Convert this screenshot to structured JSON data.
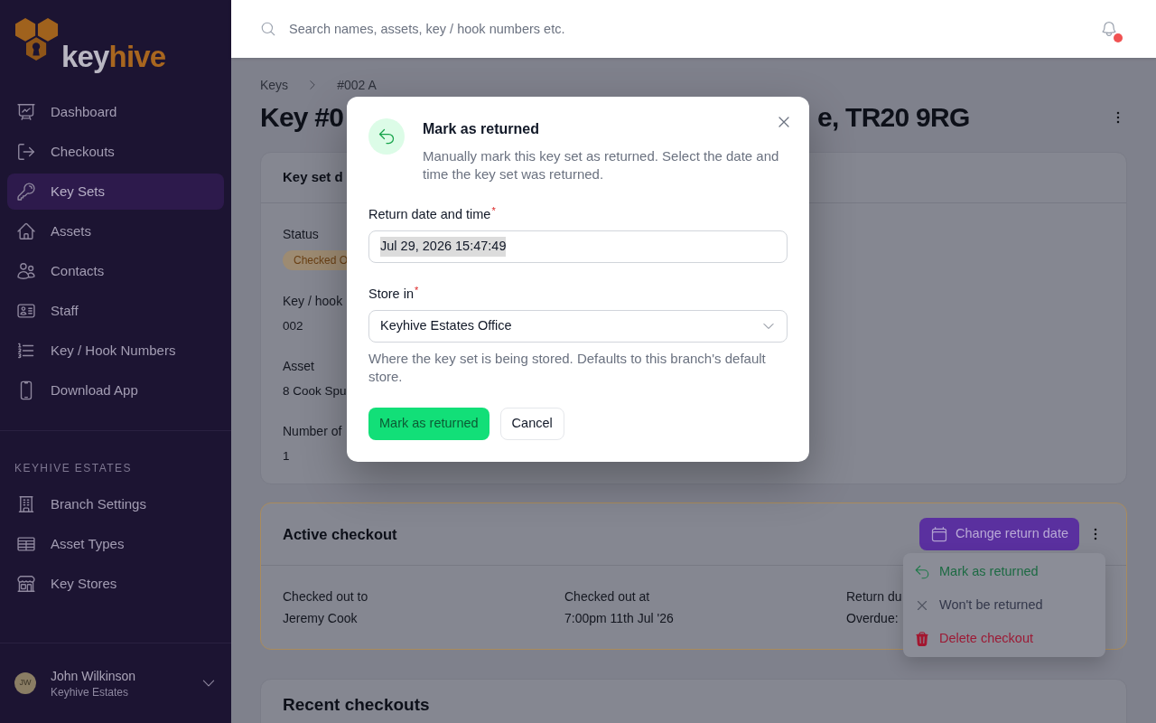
{
  "sidebar": {
    "logo": {
      "text": [
        "key",
        "hive"
      ]
    },
    "nav": [
      {
        "label": "Dashboard",
        "selected": false
      },
      {
        "label": "Checkouts",
        "selected": false
      },
      {
        "label": "Key Sets",
        "selected": true
      },
      {
        "label": "Assets",
        "selected": false
      },
      {
        "label": "Contacts",
        "selected": false
      },
      {
        "label": "Staff",
        "selected": false
      },
      {
        "label": "Key / Hook Numbers",
        "selected": false
      },
      {
        "label": "Download App",
        "selected": false
      }
    ],
    "section": {
      "title": "KEYHIVE ESTATES",
      "items": [
        {
          "label": "Branch Settings",
          "selected": false
        },
        {
          "label": "Asset Types",
          "selected": false
        },
        {
          "label": "Key Stores",
          "selected": false
        }
      ]
    },
    "user": {
      "initials": "JW",
      "name": "John Wilkinson",
      "organisation": "Keyhive Estates"
    }
  },
  "header": {
    "search": {
      "placeholder": "Search names, assets, key / hook numbers etc."
    },
    "notifications": {
      "unread": true
    }
  },
  "breadcrumb": [
    {
      "label": "Keys"
    },
    {
      "label": "#002 A"
    }
  ],
  "page_title": {
    "visible_start": "Key #0",
    "visible_end": "e, TR20 9RG"
  },
  "key_set_card": {
    "title": "Key set d",
    "fields": [
      {
        "label": "Status",
        "kind": "badge",
        "value": "Checked O"
      },
      {
        "label": "Key / hook",
        "kind": "text",
        "value": "002"
      },
      {
        "label": "Asset",
        "kind": "text",
        "value": "8 Cook Spu"
      },
      {
        "label": "Number of",
        "kind": "text",
        "value": "1"
      }
    ]
  },
  "active_checkout_card": {
    "title": "Active checkout",
    "action_button": "Change return date",
    "fields": [
      {
        "label": "Checked out to",
        "value": "Jeremy Cook"
      },
      {
        "label": "Checked out at",
        "value": "7:00pm 11th Jul '26"
      },
      {
        "label": "Return du",
        "value": "Overdue:"
      }
    ],
    "menu": {
      "open": true,
      "items": [
        {
          "label": "Mark as returned",
          "kind": "success"
        },
        {
          "label": "Won't be returned",
          "kind": "neutral"
        },
        {
          "label": "Delete checkout",
          "kind": "danger"
        }
      ]
    }
  },
  "recent_checkouts_card": {
    "title": "Recent checkouts"
  },
  "modal": {
    "title": "Mark as returned",
    "description": "Manually mark this key set as returned. Select the date and time the key set was returned.",
    "fields": [
      {
        "kind": "datetime",
        "label": "Return date and time",
        "required_mark": "*",
        "value": "Jul 29, 2026 15:47:49",
        "value_highlighted": true
      },
      {
        "kind": "select",
        "label": "Store in",
        "required_mark": "*",
        "value": "Keyhive Estates Office",
        "help": "Where the key set is being stored. Defaults to this branch's default store."
      }
    ],
    "buttons": [
      {
        "label": "Mark as returned",
        "kind": "primary"
      },
      {
        "label": "Cancel",
        "kind": "secondary"
      }
    ]
  }
}
